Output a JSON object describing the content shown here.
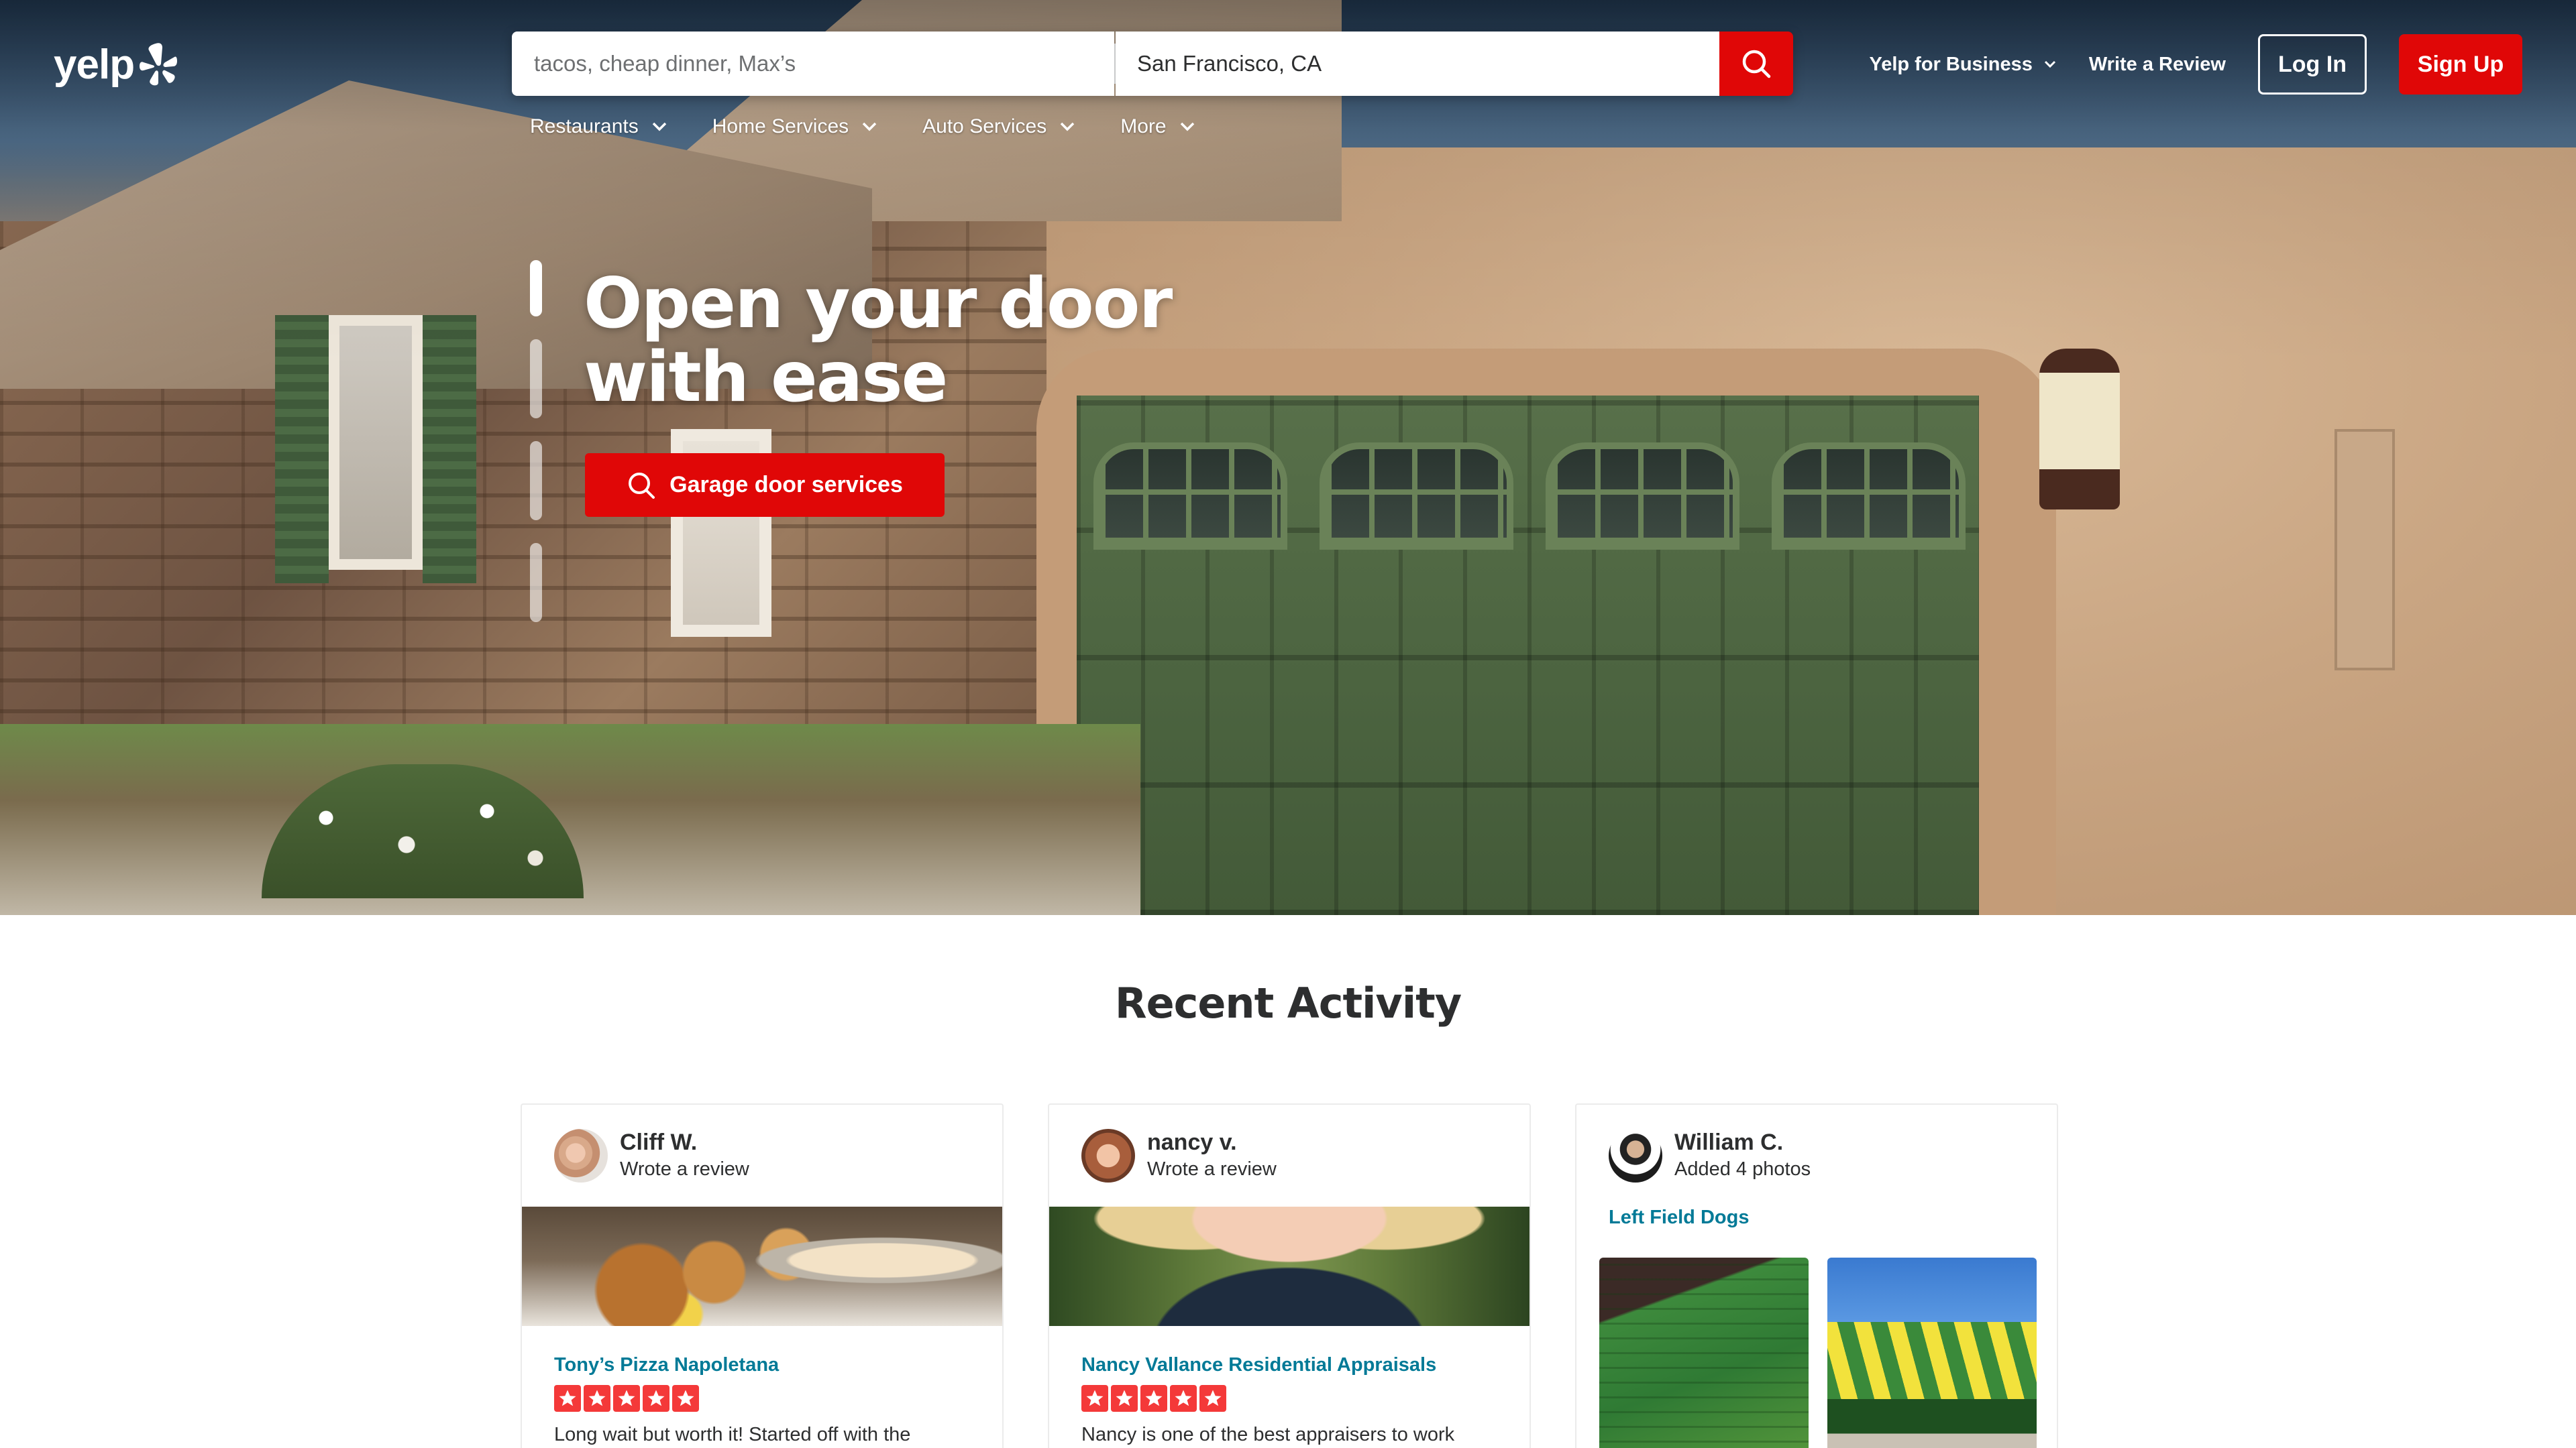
{
  "header": {
    "logo_text": "yelp",
    "search": {
      "find_placeholder": "tacos, cheap dinner, Max’s",
      "near_value": "San Francisco, CA"
    },
    "yelp_for_business": "Yelp for Business",
    "write_review": "Write a Review",
    "log_in": "Log In",
    "sign_up": "Sign Up",
    "categories": [
      "Restaurants",
      "Home Services",
      "Auto Services",
      "More"
    ]
  },
  "hero": {
    "headline_line1": "Open your door",
    "headline_line2": "with ease",
    "cta_label": "Garage door services",
    "carousel_count": 4,
    "carousel_active_index": 0
  },
  "recent_activity": {
    "title": "Recent Activity",
    "cards": [
      {
        "user": "Cliff W.",
        "action": "Wrote a review",
        "business": "Tony’s Pizza Napoletana",
        "rating": 5,
        "review_snippet": "Long wait but worth it! Started off with the"
      },
      {
        "user": "nancy v.",
        "action": "Wrote a review",
        "business": "Nancy Vallance Residential Appraisals",
        "rating": 5,
        "review_snippet": "Nancy is one of the best appraisers to work"
      },
      {
        "user": "William C.",
        "action": "Added 4 photos",
        "business": "Left Field Dogs"
      }
    ]
  },
  "colors": {
    "brand_red": "#e00707",
    "link_teal": "#027a97",
    "star_red": "#f43939",
    "text_dark": "#2d2e2f"
  },
  "icons": {
    "logo": "yelp-burst-icon",
    "search": "search-icon",
    "chevron": "chevron-down-icon",
    "star": "star-icon"
  }
}
